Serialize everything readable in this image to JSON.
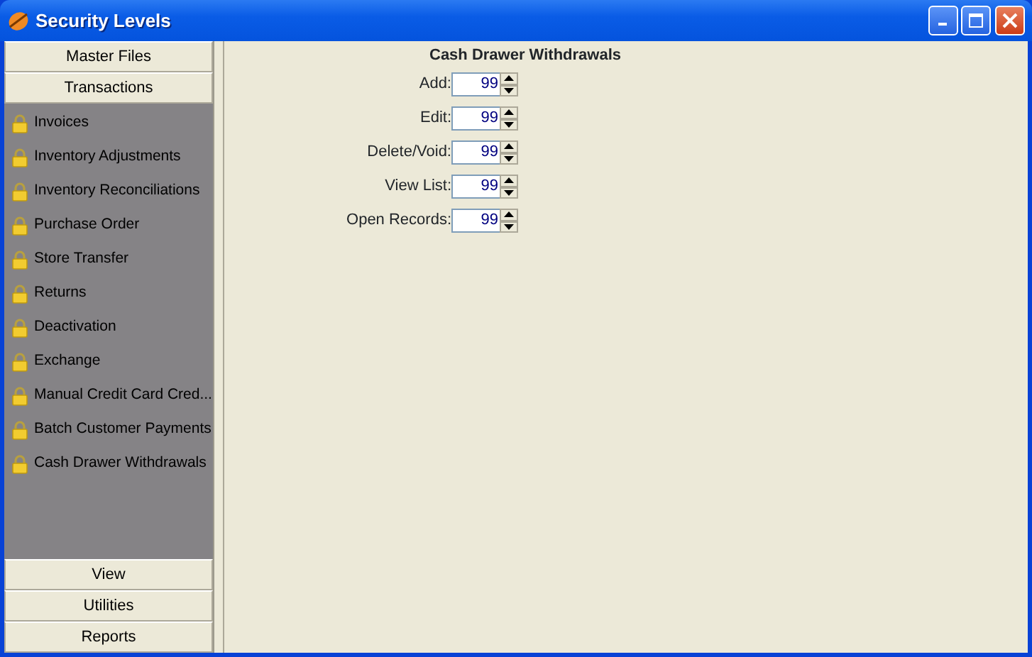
{
  "window": {
    "title": "Security Levels"
  },
  "sidebar": {
    "sections": [
      {
        "label": "Master Files"
      },
      {
        "label": "Transactions",
        "items": [
          {
            "label": "Invoices"
          },
          {
            "label": "Inventory Adjustments"
          },
          {
            "label": "Inventory Reconciliations"
          },
          {
            "label": "Purchase Order"
          },
          {
            "label": "Store Transfer"
          },
          {
            "label": "Returns"
          },
          {
            "label": "Deactivation"
          },
          {
            "label": "Exchange"
          },
          {
            "label": "Manual Credit Card Cred..."
          },
          {
            "label": "Batch Customer Payments"
          },
          {
            "label": "Cash Drawer Withdrawals"
          }
        ]
      },
      {
        "label": "View"
      },
      {
        "label": "Utilities"
      },
      {
        "label": "Reports"
      }
    ]
  },
  "form": {
    "title": "Cash Drawer Withdrawals",
    "fields": [
      {
        "label": "Add:",
        "value": "99"
      },
      {
        "label": "Edit:",
        "value": "99"
      },
      {
        "label": "Delete/Void:",
        "value": "99"
      },
      {
        "label": "View List:",
        "value": "99"
      },
      {
        "label": "Open Records:",
        "value": "99"
      }
    ]
  }
}
